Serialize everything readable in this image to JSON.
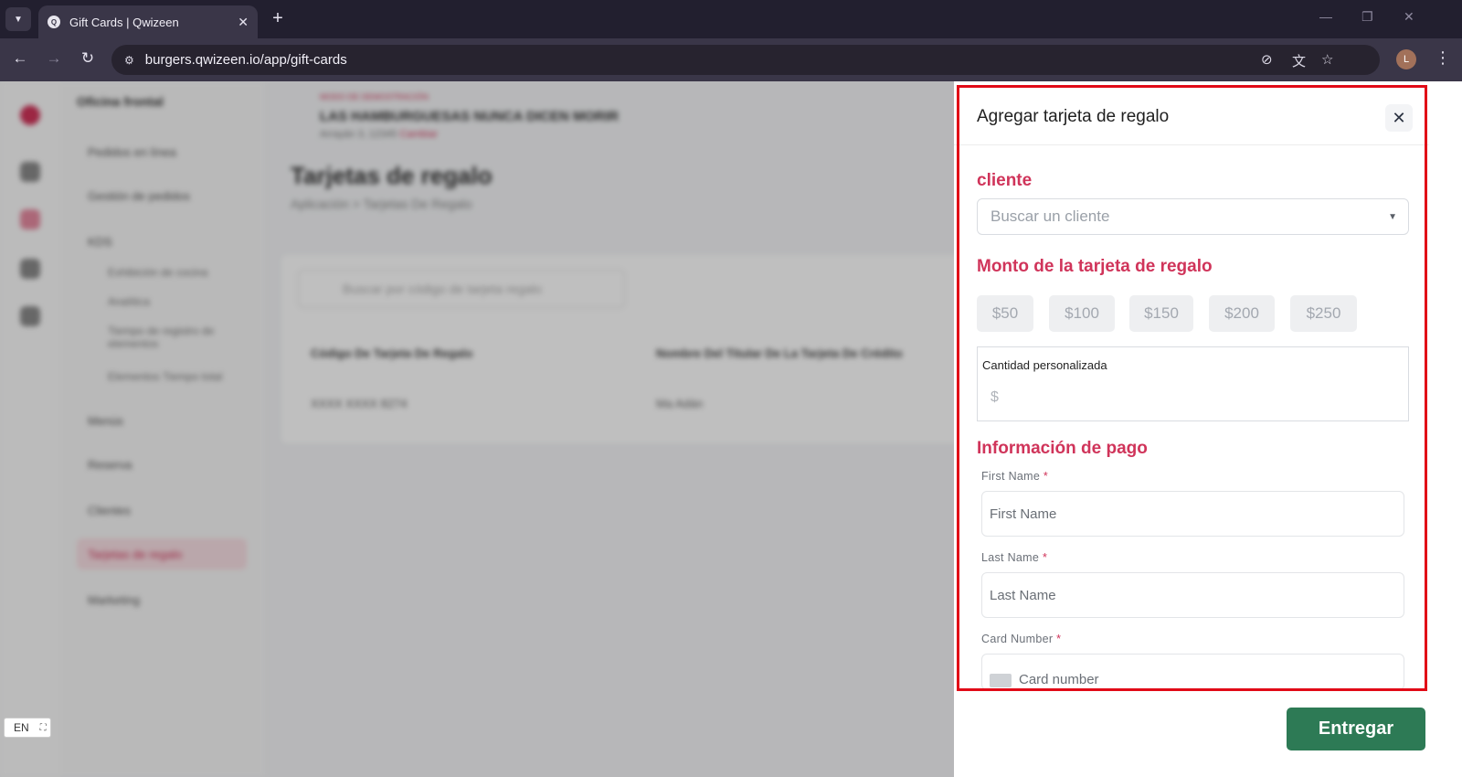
{
  "browser": {
    "tab_title": "Gift Cards | Qwizeen",
    "url": "burgers.qwizeen.io/app/gift-cards",
    "profile_initial": "L"
  },
  "background": {
    "sidebar_title": "Oficina frontal",
    "sidebar_items": [
      "Pedidos en línea",
      "Gestión de pedidos",
      "KDS",
      "Menús",
      "Reserva",
      "Clientes",
      "Tarjetas de regalo",
      "Marketing"
    ],
    "sidebar_subitems": [
      "Exhibición de cocina",
      "Analítica",
      "Tiempo de registro de elementos",
      "Elementos Tiempo total"
    ],
    "store_label": "MODO DE DEMOSTRACIÓN",
    "store_name": "LAS HAMBURGUESAS NUNCA DICEN MORIR",
    "store_address": "Arrayán 3, 12345",
    "store_change": "Cambiar",
    "page_title": "Tarjetas de regalo",
    "breadcrumb": "Aplicación  >  Tarjetas De Regalo",
    "search_placeholder": "Buscar por código de tarjeta regalo",
    "col_code": "Código De Tarjeta De Regalo",
    "col_holder": "Nombre Del Titular De La Tarjeta De Crédito",
    "row_code": "XXXX XXXX 8274",
    "row_holder": "Ma Adán",
    "lang": "EN"
  },
  "drawer": {
    "title": "Agregar tarjeta de regalo",
    "customer_heading": "cliente",
    "customer_placeholder": "Buscar un cliente",
    "amount_heading": "Monto de la tarjeta de regalo",
    "amounts": [
      "$50",
      "$100",
      "$150",
      "$200",
      "$250"
    ],
    "custom_label": "Cantidad personalizada",
    "custom_placeholder": "$",
    "payment_heading": "Información de pago",
    "first_name_label": "First Name",
    "first_name_placeholder": "First Name",
    "last_name_label": "Last Name",
    "last_name_placeholder": "Last Name",
    "card_number_label": "Card Number",
    "card_number_placeholder": "Card number",
    "required_mark": "*",
    "submit_label": "Entregar"
  },
  "colors": {
    "accent": "#d0345a",
    "submit": "#2d7a55",
    "highlight": "#e10a17"
  }
}
